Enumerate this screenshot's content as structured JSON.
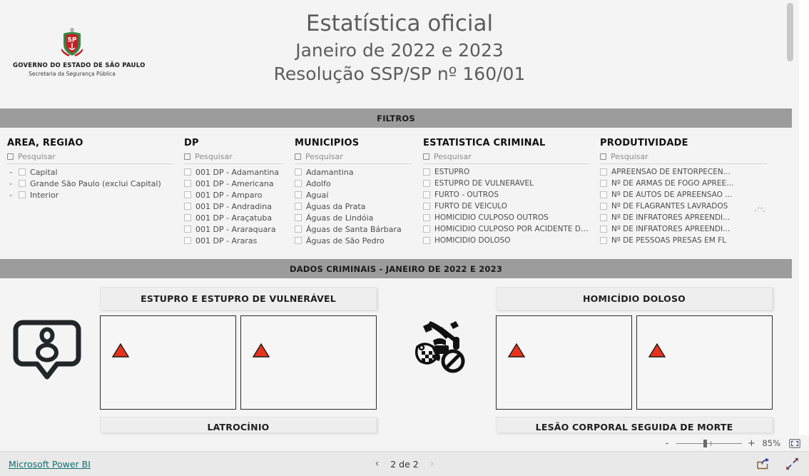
{
  "header": {
    "logo": {
      "icon": "sao-paulo-crest-icon",
      "line1": "GOVERNO DO ESTADO DE SÃO PAULO",
      "line2": "Secretaria da Segurança Pública"
    },
    "title_main": "Estatística oficial",
    "title_sub1": "Janeiro de 2022 e 2023",
    "title_sub2": "Resolução SSP/SP nº 160/01"
  },
  "banners": {
    "filtros": "FILTROS",
    "dados": "DADOS CRIMINAIS - JANEIRO DE 2022 E 2023"
  },
  "search_placeholder": "Pesquisar",
  "slicers": [
    {
      "id": "area-regiao",
      "title": "ÁREA, REGIÃO",
      "placeholder": "Pesquisar",
      "expandable": true,
      "items": [
        "Capital",
        "Grande São Paulo (exclui Capital)",
        "Interior"
      ]
    },
    {
      "id": "dp",
      "title": "DP",
      "placeholder": "Pesquisar",
      "expandable": false,
      "items": [
        "001 DP - Adamantina",
        "001 DP - Americana",
        "001 DP - Amparo",
        "001 DP - Andradina",
        "001 DP - Araçatuba",
        "001 DP - Araraquara",
        "001 DP - Araras"
      ]
    },
    {
      "id": "municipios",
      "title": "MUNICÍPIOS",
      "placeholder": "Pesquisar",
      "expandable": false,
      "items": [
        "Adamantina",
        "Adolfo",
        "Aguaí",
        "Águas da Prata",
        "Águas de Lindóia",
        "Águas de Santa Bárbara",
        "Águas de São Pedro"
      ]
    },
    {
      "id": "estatistica-criminal",
      "title": "ESTATÍSTICA CRIMINAL",
      "placeholder": "Pesquisar",
      "expandable": false,
      "items": [
        "ESTUPRO",
        "ESTUPRO DE VULNERÁVEL",
        "FURTO - OUTROS",
        "FURTO DE VEÍCULO",
        "HOMICÍDIO CULPOSO OUTROS",
        "HOMICÍDIO CULPOSO POR ACIDENTE DE ...",
        "HOMICÍDIO DOLOSO"
      ]
    },
    {
      "id": "produtividade",
      "title": "PRODUTIVIDADE",
      "placeholder": "Pesquisar",
      "expandable": false,
      "items": [
        "APREENSÃO DE ENTORPECEN...",
        "Nº DE ARMAS DE FOGO APREE...",
        "Nº DE AUTOS DE APREENSÃO ...",
        "Nº DE FLAGRANTES LAVRADOS",
        "Nº DE INFRATORES APREENDI...",
        "Nº DE INFRATORES APREENDI...",
        "Nº DE PESSOAS PRESAS EM FL"
      ]
    }
  ],
  "dados_panels": [
    {
      "id": "crimes-contra-pessoa",
      "icon": "person-shield-icon",
      "cards": [
        {
          "title": "ESTUPRO E ESTUPRO DE VULNERÁVEL",
          "boxes": [
            {
              "marker": "red-triangle-up"
            },
            {
              "marker": "red-triangle-up"
            }
          ]
        }
      ],
      "next_card_title": "LATROCÍNIO"
    },
    {
      "id": "homicidios",
      "icon": "weapons-prohibited-icon",
      "cards": [
        {
          "title": "HOMICÍDIO DOLOSO",
          "boxes": [
            {
              "marker": "red-triangle-up"
            },
            {
              "marker": "red-triangle-up"
            }
          ]
        }
      ],
      "next_card_title": "LESÃO CORPORAL SEGUIDA DE MORTE"
    }
  ],
  "zoom": {
    "minus_label": "-",
    "plus_label": "+",
    "percent": "85%",
    "fit_icon": "fit-to-page-icon"
  },
  "statusbar": {
    "brand_link": "Microsoft Power BI",
    "prev_icon": "chevron-left-icon",
    "page_indicator": "2 de 2",
    "next_icon": "chevron-right-icon",
    "share_icon": "share-icon",
    "fullscreen_icon": "fullscreen-icon"
  },
  "colors": {
    "banner_bg": "#9c9c9c",
    "canvas_bg": "#f4f4f4",
    "marker_red": "#e8331c",
    "link_teal": "#0f6e6e",
    "card_header_bg": "#eeeeee"
  }
}
